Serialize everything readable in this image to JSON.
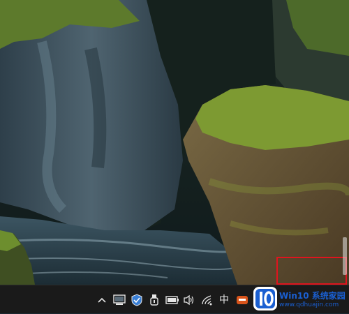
{
  "desktop": {
    "wallpaper": "desert-of-rocks-scene"
  },
  "taskbar": {
    "tray_icons": [
      {
        "name": "chevron-up-icon"
      },
      {
        "name": "network-drive-icon"
      },
      {
        "name": "security-shield-icon"
      },
      {
        "name": "usb-device-icon"
      },
      {
        "name": "battery-icon"
      },
      {
        "name": "volume-icon"
      },
      {
        "name": "wifi-icon"
      },
      {
        "name": "input-method-icon",
        "label": "中"
      },
      {
        "name": "app-tray-icon"
      }
    ]
  },
  "watermark": {
    "logo_text": "10",
    "brand": "Win10 系统家园",
    "url": "www.qdhuajin.com"
  },
  "colors": {
    "taskbar_bg": "#1a1a1a",
    "highlight": "#e0141e",
    "watermark_blue": "#1a5fd1"
  }
}
